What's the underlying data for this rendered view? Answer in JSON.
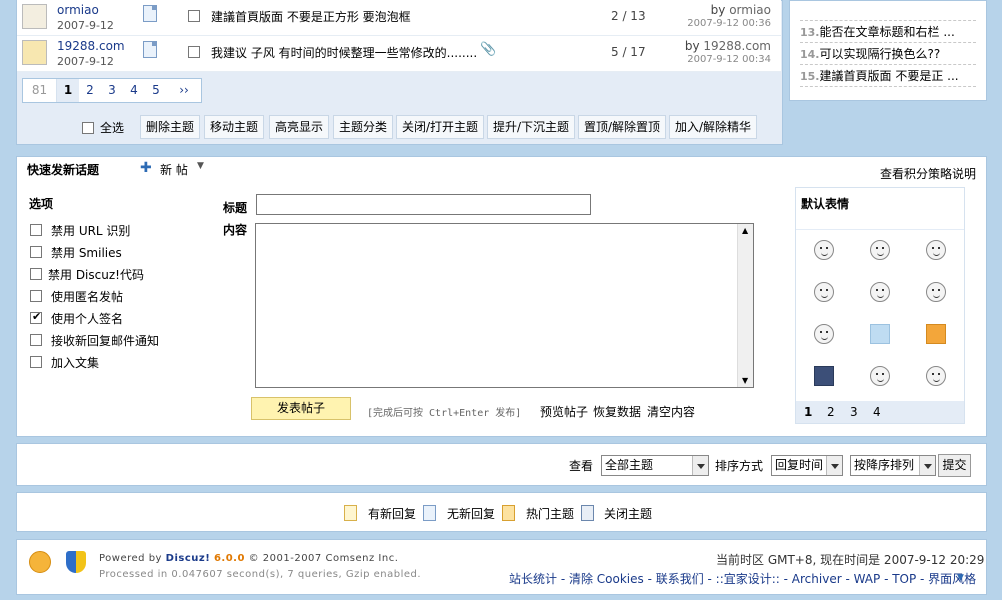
{
  "threads": [
    {
      "author": "ormiao",
      "date": "2007-9-12",
      "title": "建議首頁版面  不要是正方形  要泡泡框",
      "counts": "2 / 13",
      "by": "by",
      "last_author": "ormiao",
      "last_time": "2007-9-12 00:36"
    },
    {
      "author": "19288.com",
      "date": "2007-9-12",
      "title": "我建议  子风  有时间的时候整理一些常修改的........",
      "counts": "5 / 17",
      "by": "by",
      "last_author": "19288.com",
      "last_time": "2007-9-12 00:34"
    }
  ],
  "pager": {
    "first": "81",
    "pages": [
      "1",
      "2",
      "3",
      "4",
      "5"
    ],
    "next": "››"
  },
  "mod": {
    "select_all": "全选",
    "buttons": [
      "删除主题",
      "移动主题",
      "高亮显示",
      "主题分类",
      "关闭/打开主题",
      "提升/下沉主题",
      "置顶/解除置顶",
      "加入/解除精华"
    ]
  },
  "recent": [
    {
      "num": "13.",
      "text": "能否在文章标题和右栏 ..."
    },
    {
      "num": "14.",
      "text": "可以实现隔行换色么??"
    },
    {
      "num": "15.",
      "text": "建議首頁版面  不要是正 ..."
    }
  ],
  "quick": {
    "title": "快速发新话题",
    "new_post": "新  帖",
    "credit_link": "查看积分策略说明",
    "options_title": "选项",
    "options": [
      {
        "label": "禁用  URL 识别",
        "checked": false
      },
      {
        "label": "禁用  Smilies",
        "checked": false
      },
      {
        "label": "禁用  Discuz!代码",
        "checked": false
      },
      {
        "label": "使用匿名发帖",
        "checked": false
      },
      {
        "label": "使用个人签名",
        "checked": true
      },
      {
        "label": "接收新回复邮件通知",
        "checked": false
      },
      {
        "label": "加入文集",
        "checked": false
      }
    ],
    "subject_label": "标题",
    "content_label": "内容",
    "submit": "发表帖子",
    "hint": "[完成后可按 Ctrl+Enter 发布]",
    "links": [
      "预览帖子",
      "恢复数据",
      "清空内容"
    ],
    "smilies_title": "默认表情",
    "smilies_pages": [
      "1",
      "2",
      "3",
      "4"
    ]
  },
  "filter": {
    "view_label": "查看",
    "view_value": "全部主题",
    "sort_label": "排序方式",
    "sort_value": "回复时间",
    "order_value": "按降序排列",
    "submit": "提交"
  },
  "legend": [
    "有新回复",
    "无新回复",
    "热门主题",
    "关闭主题"
  ],
  "footer": {
    "powered_prefix": "Powered by ",
    "powered_name": "Discuz!",
    "powered_version": "6.0.0",
    "powered_suffix": " © 2001-2007 Comsenz Inc.",
    "processed": "Processed in 0.047607 second(s), 7 queries, Gzip enabled.",
    "timezone": "当前时区  GMT+8, 现在时间是  2007-9-12 20:29",
    "links": "站长统计 - 清除  Cookies - 联系我们 - ::宜家设计:: - Archiver - WAP - TOP - 界面风格"
  },
  "colors": {
    "accent": "#1a3a8a",
    "bg": "#b7d3ea",
    "version": "#e07800"
  }
}
